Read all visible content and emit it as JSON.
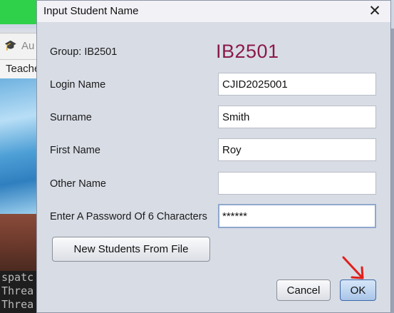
{
  "background": {
    "tab_label": "Au",
    "menu_label": "Teache",
    "console_lines": [
      "spatc",
      "Threa",
      "Threa"
    ]
  },
  "dialog": {
    "title": "Input Student Name",
    "close_icon": "close-icon",
    "group_label": "Group: IB2501",
    "group_code": "IB2501",
    "group_code_color": "#8b1a4a",
    "fields": {
      "login": {
        "label": "Login Name",
        "value": "CJID2025001"
      },
      "surname": {
        "label": "Surname",
        "value": "Smith"
      },
      "first_name": {
        "label": "First Name",
        "value": "Roy"
      },
      "other_name": {
        "label": "Other Name",
        "value": ""
      },
      "password": {
        "label": "Enter A Password Of 6 Characters",
        "value": "******"
      }
    },
    "buttons": {
      "new_from_file": "New Students From File",
      "cancel": "Cancel",
      "ok": "OK"
    },
    "annotation": {
      "icon": "arrow-annotation-icon",
      "color": "#e0201c"
    }
  }
}
